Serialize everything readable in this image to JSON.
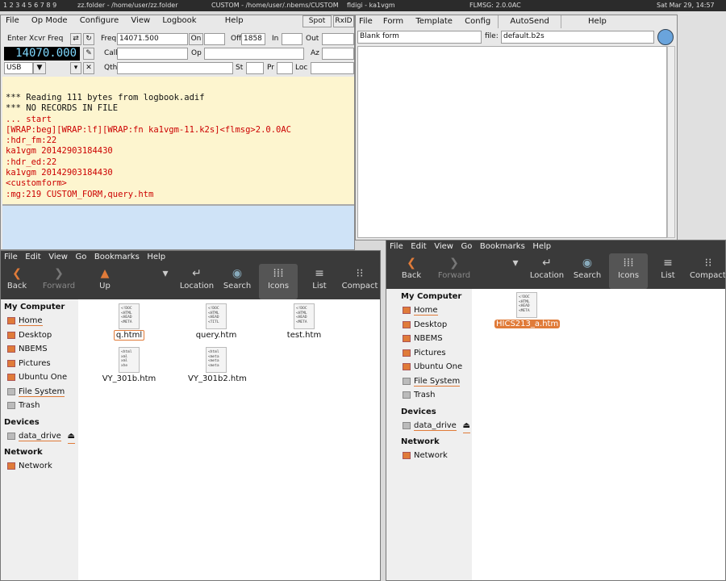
{
  "taskbar": {
    "workspaces": "1 2 3 4 5 6 7 8 9",
    "tasks": [
      "zz.folder - /home/user/zz.folder",
      "CUSTOM - /home/user/.nbems/CUSTOM",
      "fldigi - ka1vgm",
      "FLMSG: 2.0.0AC"
    ],
    "clock": "Sat Mar 29, 14:57"
  },
  "fldigi": {
    "menu": [
      "File",
      "Op Mode",
      "Configure",
      "View",
      "Logbook",
      "Help"
    ],
    "spot_label": "Spot",
    "rxid_label": "RxID",
    "enter_xcvr_freq": "Enter Xcvr Freq",
    "freq_label": "Freq",
    "freq_value": "14071.500",
    "on_label": "On",
    "off_label": "Off",
    "off_value": "1858",
    "in_label": "In",
    "out_label": "Out",
    "freq_display": "14070.000",
    "call_label": "Call",
    "op_label": "Op",
    "az_label": "Az",
    "mode_value": "USB",
    "qth_label": "Qth",
    "st_label": "St",
    "pr_label": "Pr",
    "loc_label": "Loc",
    "rx_lines": [
      {
        "text": "*** Reading 111 bytes from logbook.adif",
        "color": "black"
      },
      {
        "text": "*** NO RECORDS IN FILE",
        "color": "black"
      },
      {
        "text": "... start",
        "color": "red"
      },
      {
        "text": "[WRAP:beg][WRAP:lf][WRAP:fn ka1vgm-11.k2s]<flmsg>2.0.0AC",
        "color": "red"
      },
      {
        "text": ":hdr_fm:22",
        "color": "red"
      },
      {
        "text": "ka1vgm 20142903184430",
        "color": "red"
      },
      {
        "text": ":hdr_ed:22",
        "color": "red"
      },
      {
        "text": "ka1vgm 20142903184430",
        "color": "red"
      },
      {
        "text": "<customform>",
        "color": "red"
      },
      {
        "text": ":mg:219 CUSTOM_FORM,query.htm",
        "color": "red"
      }
    ]
  },
  "flmsg": {
    "menu": [
      "File",
      "Form",
      "Template",
      "Config",
      "AutoSend",
      "Help"
    ],
    "form_name": "Blank form",
    "file_label": "file:",
    "file_value": "default.b2s"
  },
  "fm_left": {
    "menu": [
      "File",
      "Edit",
      "View",
      "Go",
      "Bookmarks",
      "Help"
    ],
    "tools": [
      "Back",
      "Forward",
      "Up",
      "Location",
      "Search",
      "Icons",
      "List",
      "Compact"
    ],
    "my_computer": "My Computer",
    "places": [
      "Home",
      "Desktop",
      "NBEMS",
      "Pictures",
      "Ubuntu One",
      "File System",
      "Trash"
    ],
    "devices_header": "Devices",
    "devices": [
      "data_drive"
    ],
    "network_header": "Network",
    "network": [
      "Network"
    ],
    "files": [
      {
        "name": "q.html",
        "preview": "<!DOC\n<HTML\n<HEAD\n<META"
      },
      {
        "name": "query.htm",
        "preview": "<!DOC\n<HTML\n<HEAD\n<TITL"
      },
      {
        "name": "test.htm",
        "preview": "<!DOC\n<HTML\n<HEAD\n<META"
      },
      {
        "name": "VY_301b.htm",
        "preview": "<html\nxml\nxml\nxhe"
      },
      {
        "name": "VY_301b2.htm",
        "preview": "<html\n<meta\n<meta\n<meta"
      }
    ]
  },
  "fm_right": {
    "menu": [
      "File",
      "Edit",
      "View",
      "Go",
      "Bookmarks",
      "Help"
    ],
    "tools": [
      "Back",
      "Forward",
      "Location",
      "Search",
      "Icons",
      "List",
      "Compact"
    ],
    "my_computer": "My Computer",
    "places": [
      "Home",
      "Desktop",
      "NBEMS",
      "Pictures",
      "Ubuntu One",
      "File System",
      "Trash"
    ],
    "devices_header": "Devices",
    "devices": [
      "data_drive"
    ],
    "network_header": "Network",
    "network": [
      "Network"
    ],
    "files": [
      {
        "name": "HICS213_a.htm",
        "preview": "<!DOC\n<HTML\n<HEAD\n<META"
      }
    ]
  }
}
